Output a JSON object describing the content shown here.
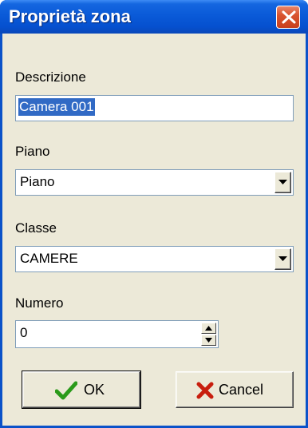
{
  "window": {
    "title": "Proprietà zona"
  },
  "fields": {
    "descrizione": {
      "label": "Descrizione",
      "value": "Camera 001"
    },
    "piano": {
      "label": "Piano",
      "value": "Piano"
    },
    "classe": {
      "label": "Classe",
      "value": "CAMERE"
    },
    "numero": {
      "label": "Numero",
      "value": "0"
    }
  },
  "buttons": {
    "ok_label": "OK",
    "cancel_label": "Cancel"
  },
  "icons": {
    "close": "close-icon",
    "dropdown": "chevron-down-icon",
    "spin_up": "arrow-up-icon",
    "spin_down": "arrow-down-icon",
    "ok": "checkmark-icon",
    "cancel": "x-cross-icon"
  },
  "colors": {
    "titlebar": "#0a5ad8",
    "close_button": "#d9542f",
    "dialog_background": "#ece9d8",
    "selection": "#316ac5",
    "ok_check": "#2a9a1a",
    "cancel_x": "#c81e0e"
  }
}
